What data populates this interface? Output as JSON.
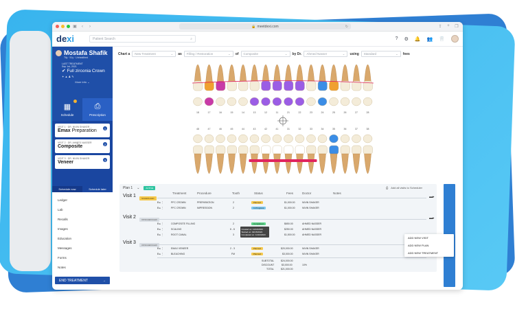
{
  "browser": {
    "url": "meetdexi.com",
    "traffic": [
      "#f25f57",
      "#f7bd2e",
      "#2ac840"
    ]
  },
  "header": {
    "logo_part1": "de",
    "logo_part2": "xi",
    "search_placeholder": "Patient Search"
  },
  "patient": {
    "name": "Mostafa Shafik",
    "meta": "Tily · 51y · Unhealthed",
    "last_treatment_label": "LAST TREATMENT",
    "last_treatment_date": "Sep 1st, 2021",
    "last_treatment_title": "Full zirconia Crown",
    "icons": "✦ ▲ ♟ ✎",
    "more_info": "More info"
  },
  "tabs": [
    {
      "label": "Schedule",
      "icon": "calendar-icon"
    },
    {
      "label": "Prescription",
      "icon": "prescription-icon"
    }
  ],
  "visits": [
    {
      "sub": "VISIT 1 · DR. NIVIN SHAKER",
      "name_bold": "Emax",
      "name_rest": " Preparation",
      "num": "1"
    },
    {
      "sub": "VISIT 2 · DR. AHMED NASSER",
      "name_bold": "Composite",
      "name_rest": "",
      "num": "2"
    },
    {
      "sub": "VISIT 3 · DR. NIVIN SHAKER",
      "name_bold": "Veneer",
      "name_rest": "",
      "num": "3"
    }
  ],
  "schedule": {
    "now": "Schedule now",
    "later": "Schedule later"
  },
  "nav": [
    "Ledger",
    "Lab",
    "Recalls",
    "Images",
    "Education",
    "Messages",
    "Forms",
    "Notes"
  ],
  "end_treatment": "END TREATMENT",
  "chartbar": {
    "chart_a": "Chart a",
    "new_treatment": "New Treatment",
    "as": "as",
    "filling": "Filling / Restoration",
    "of": "of",
    "material": "Composite",
    "by_dr": "by Dr.",
    "doctor": "Ahmed Nasser",
    "using": "using",
    "fees_type": "Standard",
    "fees": "fees"
  },
  "plan": {
    "title": "Plan 1",
    "tag": "ACTIVE",
    "add_all": "Add all visits to Scheduler",
    "cols": [
      "Treatment",
      "Procedure",
      "Tooth",
      "Status",
      "Fees",
      "Doctor",
      "Notes"
    ],
    "visits": [
      {
        "label": "Visit 1",
        "tag": "SCHEDULED",
        "rows": [
          {
            "treatment": "PFC CROWN",
            "procedure": "PREPARATION",
            "tooth": "2",
            "status": "Planned",
            "fee": "$1,000.00",
            "doctor": "NIVIN SHAKER"
          },
          {
            "treatment": "PFC CROWN",
            "procedure": "IMPRESSION",
            "tooth": "2",
            "status": "In Progress",
            "fee": "$1,000.00",
            "doctor": "NIVIN SHAKER"
          }
        ]
      },
      {
        "label": "Visit 2",
        "tag": "UNSCHEDULED",
        "rows": [
          {
            "treatment": "COMPOSITE FILLING",
            "procedure": "",
            "tooth": "2",
            "status": "Completed",
            "fee": "$650.00",
            "doctor": "AHMED NASSER"
          },
          {
            "treatment": "SCALING",
            "procedure": "",
            "tooth": "6 - 6",
            "status": "Planned",
            "fee": "$250.00",
            "doctor": "AHMED NASSER"
          },
          {
            "treatment": "ROOT CANAL",
            "procedure": "",
            "tooth": "3",
            "status": "Planned",
            "fee": "$1,500.00",
            "doctor": "AHMED NASSER"
          }
        ]
      },
      {
        "label": "Visit 3",
        "tag": "UNSCHEDULED",
        "rows": [
          {
            "treatment": "EMAX VENEER",
            "procedure": "",
            "tooth": "2 - 3",
            "status": "Planned",
            "fee": "$20,000.00",
            "doctor": "NIVIN SHAKER"
          },
          {
            "treatment": "BLEACHING",
            "procedure": "",
            "tooth": "FM",
            "status": "Planned",
            "fee": "$3,000.00",
            "doctor": "NIVIN SHAKER"
          }
        ]
      }
    ],
    "tooltip": [
      "Created on: 11/10/2023",
      "Started on: 02/15/2023",
      "Completed on: 11/10/2023"
    ],
    "totals": [
      {
        "label": "SUBTOTAL",
        "value": "$24,000.00",
        "note": ""
      },
      {
        "label": "DISCOUNT",
        "value": "$3,000.00",
        "note": "10%"
      },
      {
        "label": "TOTAL",
        "value": "$21,000.00",
        "note": ""
      }
    ]
  },
  "add_menu": [
    "ADD NEW VISIT",
    "ADD NEW PLAN",
    "ADD NEW TREATMENT"
  ],
  "colors": {
    "primary": "#1f4fa8",
    "accent": "#2f7fd3",
    "purple": "#9b5de5",
    "pink": "#e0245e",
    "blue_tooth": "#3b8de6",
    "orange_tooth": "#f0a030"
  }
}
